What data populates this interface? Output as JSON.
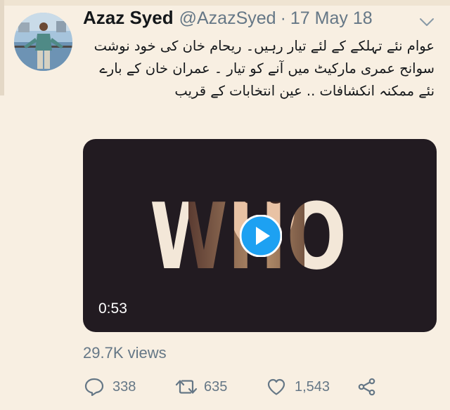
{
  "tweet": {
    "author_name": "Azaz Syed",
    "handle": "@AzazSyed",
    "separator": "·",
    "date": "17 May 18",
    "text": "عوام نئے تہلکے کے لئے تیار رہیں۔ ریحام خان کی خود نوشت سوانح عمری مارکیٹ میں آنے کو تیار ۔ عمران خان کے بارے نئے ممکنہ انکشافات .. عین انتخابات کے قریب",
    "media": {
      "overlay_word": "WHO",
      "duration": "0:53"
    },
    "views": "29.7K views",
    "actions": {
      "replies": "338",
      "retweets": "635",
      "likes": "1,543"
    }
  },
  "icons": {
    "menu": "chevron-down-icon",
    "play": "play-icon",
    "reply": "reply-icon",
    "retweet": "retweet-icon",
    "like": "heart-icon",
    "share": "share-icon"
  },
  "colors": {
    "background": "#f8efe2",
    "text": "#14171a",
    "muted": "#657786",
    "play_button": "#1da1f2",
    "media_background": "#221b21"
  }
}
